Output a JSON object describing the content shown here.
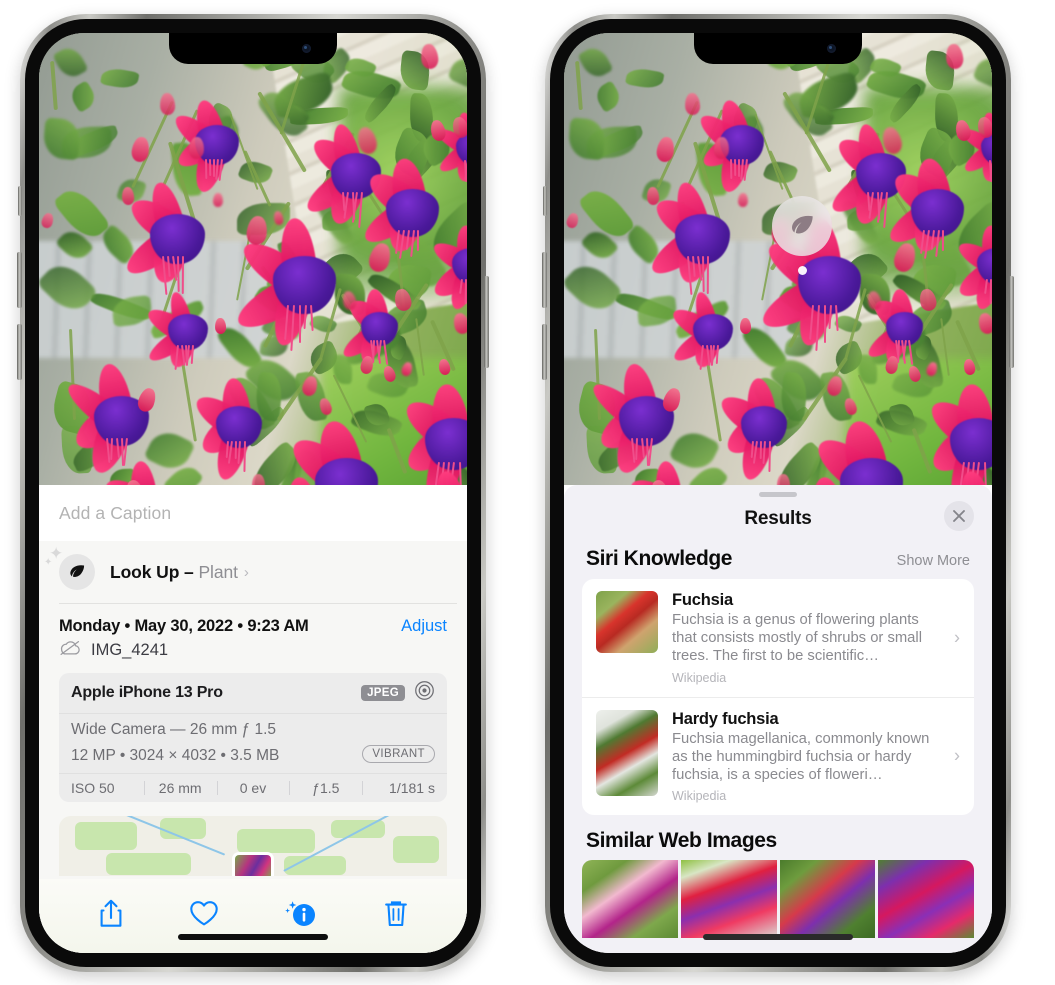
{
  "left_phone": {
    "caption": {
      "placeholder": "Add a Caption"
    },
    "lookup": {
      "label_main": "Look Up",
      "dash": " – ",
      "label_sub": "Plant",
      "chevron": "›",
      "icon": "leaf-icon",
      "sparkle": "✦",
      "sparkle_small": "✦"
    },
    "info": {
      "date": "Monday • May 30, 2022 • 9:23 AM",
      "adjust": "Adjust",
      "filename": "IMG_4241",
      "cloud_icon": "icloud-slash-icon"
    },
    "exif": {
      "device": "Apple iPhone 13 Pro",
      "format_tag": "JPEG",
      "aperture_icon": "camera-lens-icon",
      "lens_line": "Wide Camera — 26 mm ƒ 1.5",
      "size_line": "12 MP • 3024 × 4032 • 3.5 MB",
      "style_tag": "VIBRANT",
      "stats": [
        "ISO 50",
        "26 mm",
        "0 ev",
        "ƒ1.5",
        "1/181 s"
      ]
    },
    "toolbar": [
      {
        "name": "share-button",
        "icon": "share-icon"
      },
      {
        "name": "favorite-button",
        "icon": "heart-icon"
      },
      {
        "name": "info-button",
        "icon": "info-sparkle-icon"
      },
      {
        "name": "delete-button",
        "icon": "trash-icon"
      }
    ]
  },
  "right_phone": {
    "badge": {
      "icon": "leaf-icon"
    },
    "sheet": {
      "title": "Results",
      "close_icon": "close-icon"
    },
    "siri_knowledge": {
      "title": "Siri Knowledge",
      "show_more": "Show More",
      "results": [
        {
          "title": "Fuchsia",
          "description": "Fuchsia is a genus of flowering plants that consists mostly of shrubs or small trees. The first to be scientific…",
          "source": "Wikipedia",
          "chevron": "›"
        },
        {
          "title": "Hardy fuchsia",
          "description": "Fuchsia magellanica, commonly known as the hummingbird fuchsia or hardy fuchsia, is a species of floweri…",
          "source": "Wikipedia",
          "chevron": "›"
        }
      ]
    },
    "similar_web_images": {
      "title": "Similar Web Images",
      "count": 4
    }
  },
  "colors": {
    "accent_blue": "#0A84FF",
    "sheet_bg": "#F2F1F6",
    "card_bg": "#FFFFFF",
    "secondary_text": "#8E8E93",
    "tag_gray": "#8E8E93"
  }
}
